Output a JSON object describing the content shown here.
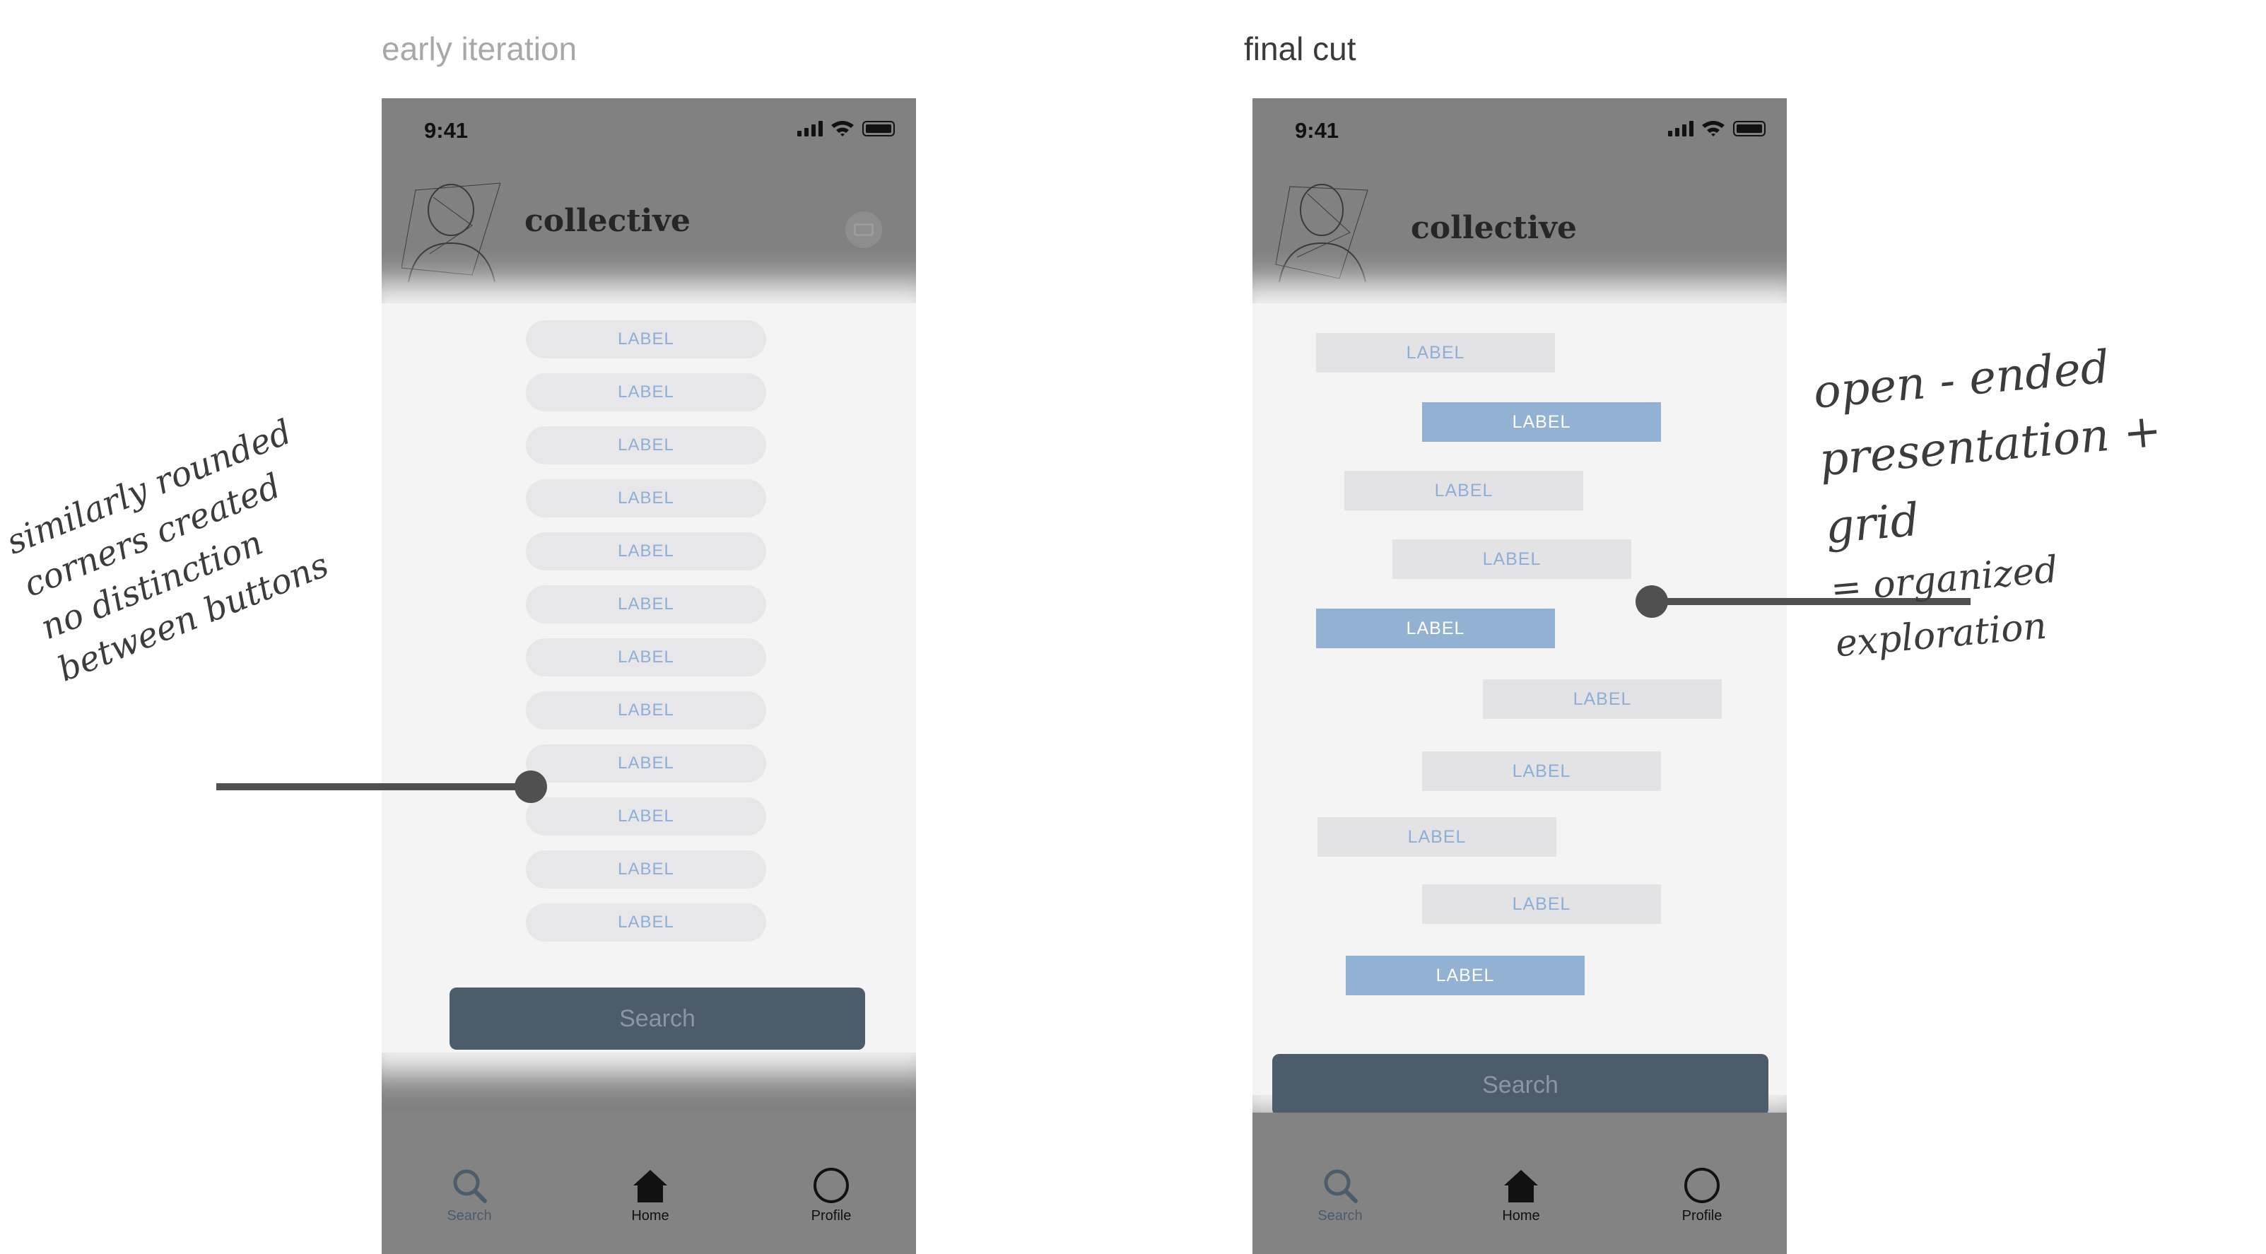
{
  "headings": {
    "early": "early iteration",
    "final": "final cut"
  },
  "phone": {
    "time": "9:41",
    "brand": "collective",
    "search": "Search",
    "tabs": [
      "Search",
      "Home",
      "Profile"
    ]
  },
  "early_labels": [
    "LABEL",
    "LABEL",
    "LABEL",
    "LABEL",
    "LABEL",
    "LABEL",
    "LABEL",
    "LABEL",
    "LABEL",
    "LABEL",
    "LABEL",
    "LABEL"
  ],
  "final_labels": [
    {
      "text": "LABEL",
      "active": false
    },
    {
      "text": "LABEL",
      "active": true
    },
    {
      "text": "LABEL",
      "active": false
    },
    {
      "text": "LABEL",
      "active": false
    },
    {
      "text": "LABEL",
      "active": true
    },
    {
      "text": "LABEL",
      "active": false
    },
    {
      "text": "LABEL",
      "active": false
    },
    {
      "text": "LABEL",
      "active": false
    },
    {
      "text": "LABEL",
      "active": false
    },
    {
      "text": "LABEL",
      "active": true
    }
  ],
  "annotations": {
    "left": "similarly rounded corners created no distinction between buttons",
    "right_line1": "open - ended",
    "right_line2": "presentation + grid",
    "right_line3": "= organized exploration"
  },
  "colors": {
    "accent": "#93b2d3",
    "label_text": "#8faed6",
    "search_btn": "#4c5c6a"
  },
  "icons": [
    "search-icon",
    "home-icon",
    "profile-icon",
    "chat-icon",
    "signal-icon",
    "wifi-icon",
    "battery-icon"
  ]
}
